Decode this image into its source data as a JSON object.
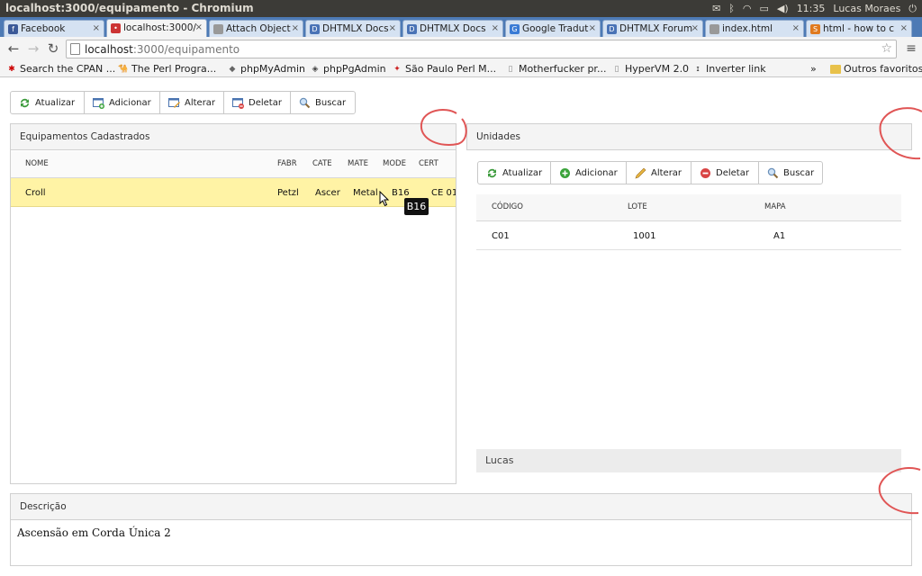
{
  "window": {
    "title": "localhost:3000/equipamento - Chromium",
    "clock": "11:35",
    "user": "Lucas Moraes"
  },
  "tabs": [
    {
      "label": "Facebook",
      "icon": "facebook-icon",
      "color": "#3b5998",
      "glyph": "f"
    },
    {
      "label": "localhost:3000/",
      "icon": "page-icon",
      "color": "#c33",
      "glyph": "•",
      "active": true
    },
    {
      "label": "Attach Object",
      "icon": "page-icon",
      "color": "#999",
      "glyph": ""
    },
    {
      "label": "DHTMLX Docs",
      "icon": "dhtmlx-icon",
      "color": "#4a73b6",
      "glyph": "D"
    },
    {
      "label": "DHTMLX Docs",
      "icon": "dhtmlx-icon",
      "color": "#4a73b6",
      "glyph": "D"
    },
    {
      "label": "Google Tradut",
      "icon": "translate-icon",
      "color": "#3a7bd5",
      "glyph": "G"
    },
    {
      "label": "DHTMLX Forum",
      "icon": "dhtmlx-icon",
      "color": "#4a73b6",
      "glyph": "D"
    },
    {
      "label": "index.html",
      "icon": "page-icon",
      "color": "#999",
      "glyph": ""
    },
    {
      "label": "html - how to c",
      "icon": "stackoverflow-icon",
      "color": "#e07a1f",
      "glyph": "S"
    }
  ],
  "address": {
    "host": "localhost",
    "path": ":3000/equipamento"
  },
  "bookmarks": [
    {
      "label": "Search the CPAN ...",
      "icon": "cpan-icon",
      "color": "#c00",
      "glyph": "✱"
    },
    {
      "label": "The Perl Progra...",
      "icon": "camel-icon",
      "color": "#444",
      "glyph": "🐪"
    },
    {
      "label": "phpMyAdmin",
      "icon": "phpmyadmin-icon",
      "color": "#666",
      "glyph": "◆"
    },
    {
      "label": "phpPgAdmin",
      "icon": "elephant-icon",
      "color": "#444",
      "glyph": "◈"
    },
    {
      "label": "São Paulo Perl M...",
      "icon": "perl-icon",
      "color": "#c22",
      "glyph": "✦"
    },
    {
      "label": "Motherfucker pr...",
      "icon": "page-icon",
      "color": "#888",
      "glyph": "▯"
    },
    {
      "label": "HyperVM 2.0",
      "icon": "page-icon",
      "color": "#888",
      "glyph": "▯"
    },
    {
      "label": "Inverter link",
      "icon": "info-icon",
      "color": "#333",
      "glyph": "ɪ"
    }
  ],
  "bookmarks_more": "»",
  "bookmarks_other": "Outros favoritos",
  "toolbar_left": {
    "refresh": "Atualizar",
    "add": "Adicionar",
    "edit": "Alterar",
    "delete": "Deletar",
    "search": "Buscar"
  },
  "toolbar_right": {
    "refresh": "Atualizar",
    "add": "Adicionar",
    "edit": "Alterar",
    "delete": "Deletar",
    "search": "Buscar"
  },
  "equipamentos": {
    "title": "Equipamentos Cadastrados",
    "columns": [
      "NOME",
      "FABR",
      "CATE",
      "MATE",
      "MODE",
      "CERT"
    ],
    "rows": [
      [
        "Croll",
        "Petzl",
        "Ascer",
        "Metal",
        "B16",
        "CE 01"
      ]
    ],
    "tooltip": "B16"
  },
  "unidades": {
    "title": "Unidades",
    "columns": [
      "CÓDIGO",
      "LOTE",
      "MAPA"
    ],
    "rows": [
      [
        "C01",
        "1001",
        "A1"
      ]
    ],
    "footer": "Lucas"
  },
  "descricao": {
    "title": "Descrição",
    "text": "Ascensão em Corda Única 2"
  },
  "colors": {
    "titlebar": "#3c3b37",
    "tabstrip": "#4d7ab5",
    "selected_row": "#fff3a5",
    "annotation": "#e05555"
  }
}
